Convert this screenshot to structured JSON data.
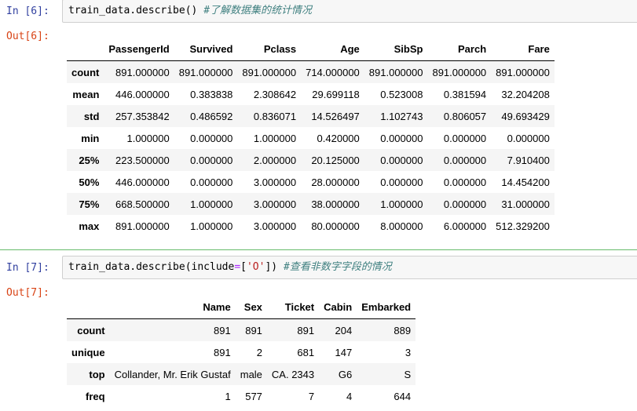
{
  "cell1": {
    "in_prompt": "In [6]:",
    "code": {
      "call": "train_data.describe()",
      "comment": "#了解数据集的统计情况"
    },
    "out_prompt": "Out[6]:",
    "table": {
      "columns": [
        "PassengerId",
        "Survived",
        "Pclass",
        "Age",
        "SibSp",
        "Parch",
        "Fare"
      ],
      "rows": [
        {
          "label": "count",
          "values": [
            "891.000000",
            "891.000000",
            "891.000000",
            "714.000000",
            "891.000000",
            "891.000000",
            "891.000000"
          ]
        },
        {
          "label": "mean",
          "values": [
            "446.000000",
            "0.383838",
            "2.308642",
            "29.699118",
            "0.523008",
            "0.381594",
            "32.204208"
          ]
        },
        {
          "label": "std",
          "values": [
            "257.353842",
            "0.486592",
            "0.836071",
            "14.526497",
            "1.102743",
            "0.806057",
            "49.693429"
          ]
        },
        {
          "label": "min",
          "values": [
            "1.000000",
            "0.000000",
            "1.000000",
            "0.420000",
            "0.000000",
            "0.000000",
            "0.000000"
          ]
        },
        {
          "label": "25%",
          "values": [
            "223.500000",
            "0.000000",
            "2.000000",
            "20.125000",
            "0.000000",
            "0.000000",
            "7.910400"
          ]
        },
        {
          "label": "50%",
          "values": [
            "446.000000",
            "0.000000",
            "3.000000",
            "28.000000",
            "0.000000",
            "0.000000",
            "14.454200"
          ]
        },
        {
          "label": "75%",
          "values": [
            "668.500000",
            "1.000000",
            "3.000000",
            "38.000000",
            "1.000000",
            "0.000000",
            "31.000000"
          ]
        },
        {
          "label": "max",
          "values": [
            "891.000000",
            "1.000000",
            "3.000000",
            "80.000000",
            "8.000000",
            "6.000000",
            "512.329200"
          ]
        }
      ]
    }
  },
  "cell2": {
    "in_prompt": "In [7]:",
    "code": {
      "pre": "train_data.describe(include",
      "op": "=",
      "open": "[",
      "str": "'O'",
      "close": "])",
      "comment": "#查看非数字字段的情况"
    },
    "out_prompt": "Out[7]:",
    "table": {
      "columns": [
        "Name",
        "Sex",
        "Ticket",
        "Cabin",
        "Embarked"
      ],
      "rows": [
        {
          "label": "count",
          "values": [
            "891",
            "891",
            "891",
            "204",
            "889"
          ]
        },
        {
          "label": "unique",
          "values": [
            "891",
            "2",
            "681",
            "147",
            "3"
          ]
        },
        {
          "label": "top",
          "values": [
            "Collander, Mr. Erik Gustaf",
            "male",
            "CA. 2343",
            "G6",
            "S"
          ]
        },
        {
          "label": "freq",
          "values": [
            "1",
            "577",
            "7",
            "4",
            "644"
          ]
        }
      ]
    }
  },
  "colors": {
    "in_prompt": "#303f9f",
    "out_prompt": "#d84315",
    "comment": "#408080",
    "string": "#ba2121",
    "operator": "#aa22ff",
    "cell_border": "#cfcfcf",
    "selected_cell": "#66bb6a"
  }
}
